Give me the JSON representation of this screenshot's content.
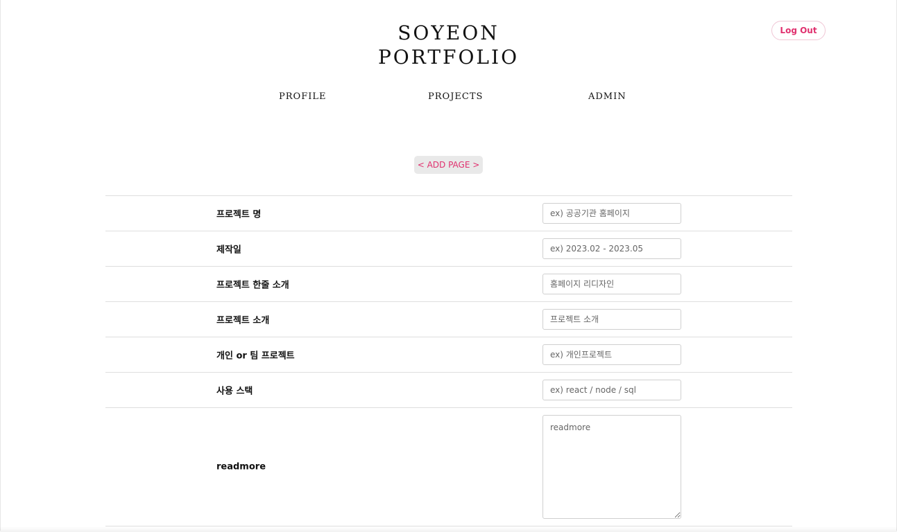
{
  "header": {
    "logo_line1": "SOYEON",
    "logo_line2": "PORTFOLIO",
    "logout_label": "Log Out"
  },
  "nav": {
    "items": [
      "PROFILE",
      "PROJECTS",
      "ADMIN"
    ]
  },
  "page": {
    "add_page_label": "< ADD PAGE >"
  },
  "form": {
    "rows": [
      {
        "label": "프로젝트 명",
        "placeholder": "ex) 공공기관 홈페이지"
      },
      {
        "label": "제작일",
        "placeholder": "ex) 2023.02 - 2023.05"
      },
      {
        "label": "프로젝트 한줄 소개",
        "placeholder": "홈페이지 리디자인"
      },
      {
        "label": "프로젝트 소개",
        "placeholder": "프로젝트 소개"
      },
      {
        "label": "개인 or 팀 프로젝트",
        "placeholder": "ex) 개인프로젝트"
      },
      {
        "label": "사용 스택",
        "placeholder": "ex) react / node / sql"
      },
      {
        "label": "readmore",
        "placeholder": "readmore"
      }
    ]
  },
  "colors": {
    "accent": "#e0306e",
    "add_page_bg": "#e9e9e9"
  }
}
